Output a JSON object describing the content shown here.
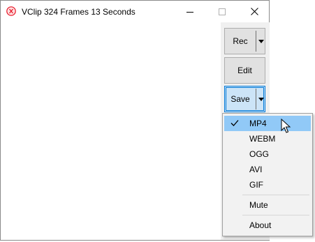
{
  "window": {
    "title": "VClip 324 Frames 13 Seconds",
    "controls": {
      "minimize_icon": "minimize-icon",
      "maximize_icon": "maximize-icon",
      "close_icon": "close-icon"
    }
  },
  "toolbar": {
    "rec_label": "Rec",
    "edit_label": "Edit",
    "save_label": "Save"
  },
  "save_menu": {
    "items": [
      {
        "label": "MP4",
        "checked": true,
        "highlighted": true
      },
      {
        "label": "WEBM"
      },
      {
        "label": "OGG"
      },
      {
        "label": "AVI"
      },
      {
        "label": "GIF"
      },
      {
        "label": "Mute"
      },
      {
        "label": "About"
      }
    ]
  },
  "colors": {
    "accent": "#0078d7",
    "highlight": "#91c9f7",
    "icon": "#e81123"
  }
}
